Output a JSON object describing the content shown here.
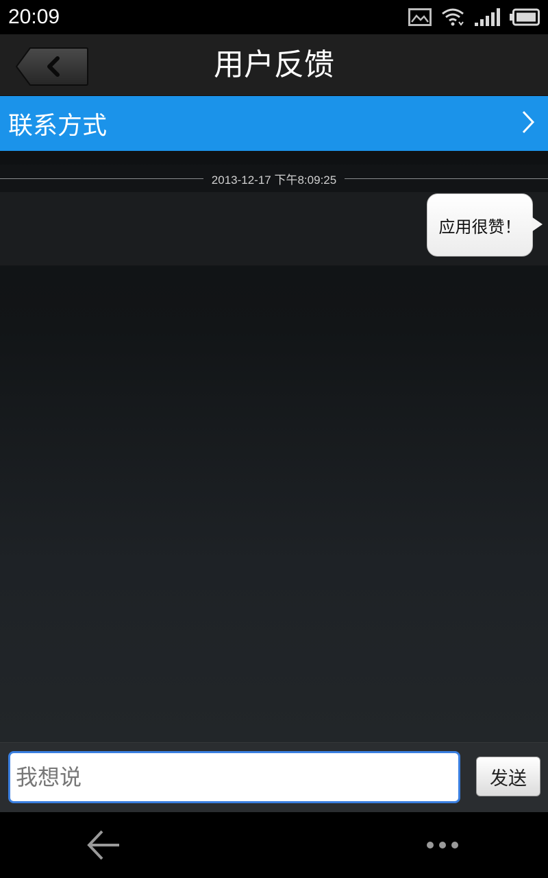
{
  "status_bar": {
    "time": "20:09",
    "icons": [
      "image-notification-icon",
      "wifi-icon",
      "signal-icon",
      "battery-icon"
    ]
  },
  "header": {
    "title": "用户反馈",
    "back_icon": "chevron-left-icon"
  },
  "contact": {
    "label": "联系方式",
    "chevron_icon": "chevron-right-icon",
    "background_color": "#1b93ea"
  },
  "chat": {
    "messages": [
      {
        "timestamp": "2013-12-17 下午8:09:25",
        "text": "应用很赞！",
        "sender": "self"
      }
    ]
  },
  "composer": {
    "placeholder": "我想说",
    "value": "",
    "send_label": "发送",
    "focus_color": "#3a7fe0"
  },
  "nav": {
    "back_icon": "arrow-left-icon",
    "more_icon": "more-dots-icon"
  }
}
